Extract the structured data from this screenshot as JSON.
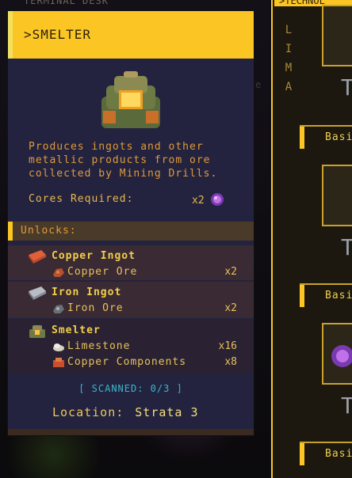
{
  "background": {
    "top_text": "TERMINAL DESK",
    "side_text": "e"
  },
  "card": {
    "title": ">SMELTER",
    "description": "Produces ingots and other metallic products from ore collected by Mining Drills.",
    "cores_label": "Cores Required:",
    "cores_qty": "x2",
    "unlocks_label": "Unlocks:",
    "recipes": [
      {
        "name": "Copper Ingot",
        "icon": "copper-ingot-icon",
        "ingredients": [
          {
            "name": "Copper Ore",
            "qty": "x2",
            "icon": "copper-ore-icon"
          }
        ]
      },
      {
        "name": "Iron Ingot",
        "icon": "iron-ingot-icon",
        "ingredients": [
          {
            "name": "Iron Ore",
            "qty": "x2",
            "icon": "iron-ore-icon"
          }
        ]
      },
      {
        "name": "Smelter",
        "icon": "smelter-icon",
        "ingredients": [
          {
            "name": "Limestone",
            "qty": "x16",
            "icon": "limestone-icon"
          },
          {
            "name": "Copper Components",
            "qty": "x8",
            "icon": "copper-components-icon"
          }
        ]
      }
    ],
    "scanned": "[ SCANNED: 0/3 ]",
    "location_label": "Location:",
    "location_value": "Strata 3"
  },
  "tech_panel": {
    "tab_title": ">TECHNOL",
    "side_letters": [
      "L",
      "I",
      "M",
      "A"
    ],
    "tier_glyph": "T",
    "rows": [
      "Basi",
      "Basi",
      "Basi"
    ]
  },
  "colors": {
    "accent": "#fbc523",
    "card_bg": "#232340",
    "text_orange": "#e09a38",
    "scan_cyan": "#3ab7c8"
  }
}
